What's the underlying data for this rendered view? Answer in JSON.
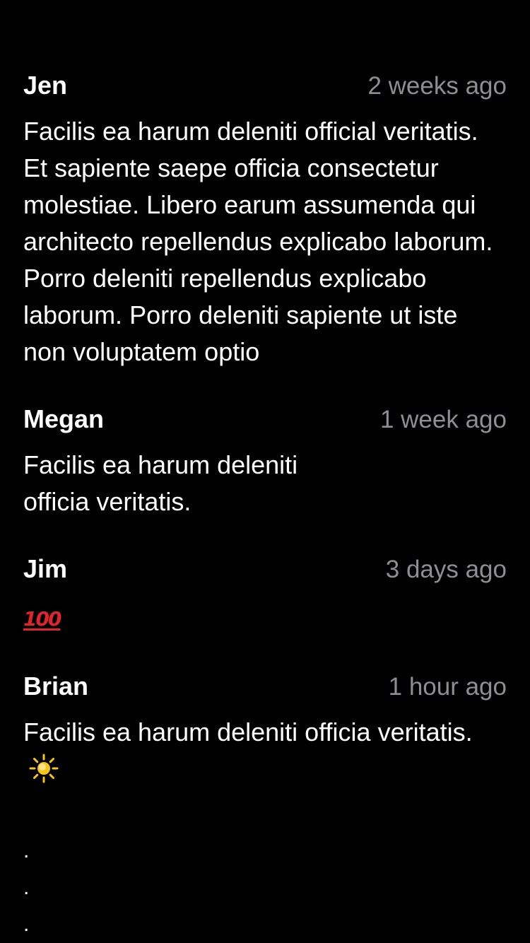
{
  "comments": [
    {
      "author": "Jen",
      "time": "2 weeks ago",
      "text": "Facilis ea harum deleniti official veritatis. Et sapiente saepe officia consectetur molestiae. Libero earum assumenda qui architecto repellendus explicabo laborum. Porro deleniti repellendus explicabo laborum. Porro deleniti sapiente ut iste non voluptatem optio"
    },
    {
      "author": "Megan",
      "time": "1 week ago",
      "text": "Facilis ea harum deleniti officia veritatis."
    },
    {
      "author": "Jim",
      "time": "3 days ago",
      "text": "100",
      "icon": "hundred-points-emoji"
    },
    {
      "author": "Brian",
      "time": "1 hour ago",
      "text": "Facilis ea harum deleniti officia veritatis.",
      "icon": "sun-emoji"
    }
  ],
  "continuation": {
    "dots": [
      ".",
      ".",
      "."
    ]
  },
  "colors": {
    "background": "#000000",
    "text": "#ffffff",
    "timestamp": "#8e8e93",
    "hundred": "#e0242b",
    "sun": "#f5c518"
  }
}
